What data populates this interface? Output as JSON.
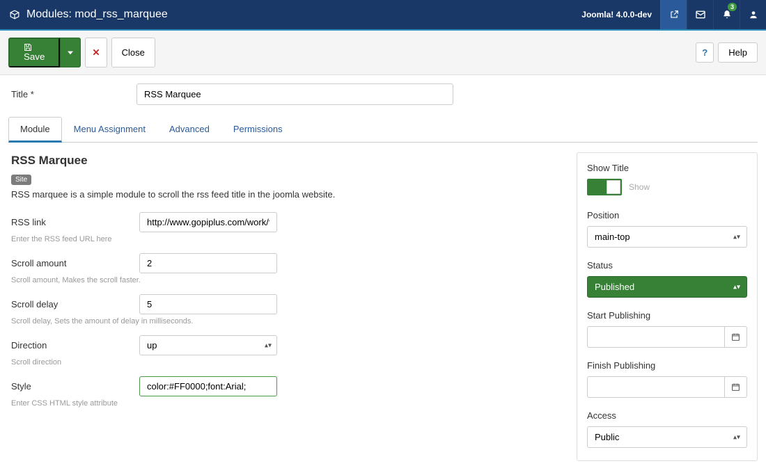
{
  "header": {
    "title": "Modules: mod_rss_marquee",
    "version": "Joomla! 4.0.0-dev",
    "notif_count": "3"
  },
  "toolbar": {
    "save": "Save",
    "close": "Close",
    "help": "Help",
    "helpq": "?"
  },
  "title_field": {
    "label": "Title *",
    "value": "RSS Marquee"
  },
  "tabs": {
    "module": "Module",
    "menu_assignment": "Menu Assignment",
    "advanced": "Advanced",
    "permissions": "Permissions"
  },
  "module": {
    "heading": "RSS Marquee",
    "site_badge": "Site",
    "description": "RSS marquee is a simple module to scroll the rss feed title in the joomla website.",
    "fields": {
      "rss_link": {
        "label": "RSS link",
        "value": "http://www.gopiplus.com/work/feed/",
        "hint": "Enter the RSS feed URL here"
      },
      "scroll_amount": {
        "label": "Scroll amount",
        "value": "2",
        "hint": "Scroll amount, Makes the scroll faster."
      },
      "scroll_delay": {
        "label": "Scroll delay",
        "value": "5",
        "hint": "Scroll delay, Sets the amount of delay in milliseconds."
      },
      "direction": {
        "label": "Direction",
        "value": "up",
        "hint": "Scroll direction"
      },
      "style": {
        "label": "Style",
        "value": "color:#FF0000;font:Arial;",
        "hint": "Enter CSS HTML style attribute"
      }
    }
  },
  "sidebar": {
    "show_title": {
      "label": "Show Title",
      "state": "Show"
    },
    "position": {
      "label": "Position",
      "value": "main-top"
    },
    "status": {
      "label": "Status",
      "value": "Published"
    },
    "start_publishing": {
      "label": "Start Publishing",
      "value": ""
    },
    "finish_publishing": {
      "label": "Finish Publishing",
      "value": ""
    },
    "access": {
      "label": "Access",
      "value": "Public"
    }
  }
}
